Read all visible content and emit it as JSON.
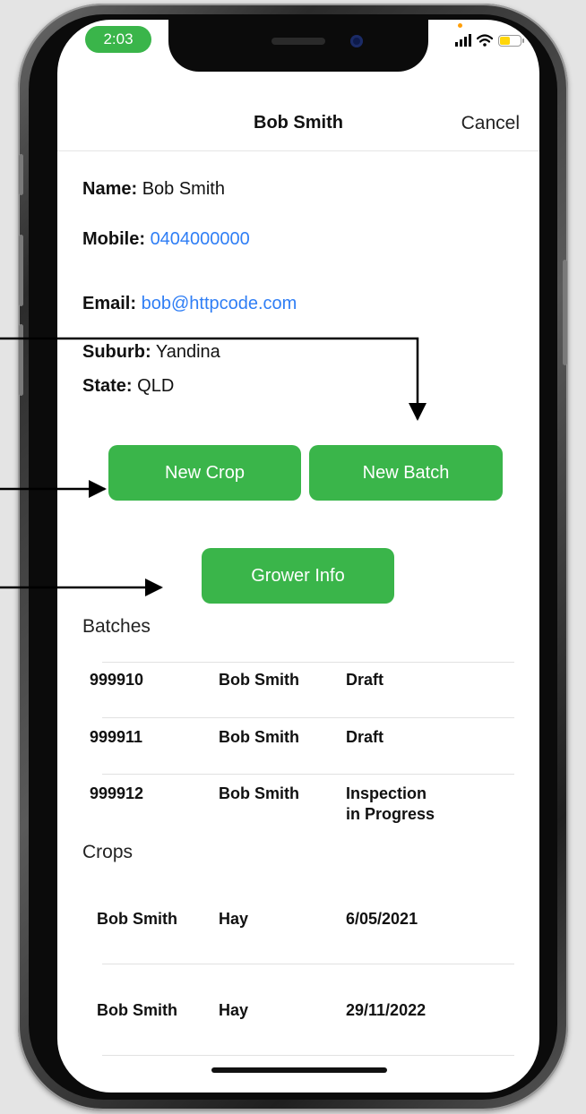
{
  "status_bar": {
    "time": "2:03"
  },
  "nav": {
    "title": "Bob Smith",
    "cancel_label": "Cancel"
  },
  "contact": {
    "name_label": "Name:",
    "name_value": "Bob Smith",
    "mobile_label": "Mobile:",
    "mobile_value": "0404000000",
    "email_label": "Email:",
    "email_value": "bob@httpcode.com",
    "suburb_label": "Suburb:",
    "suburb_value": "Yandina",
    "state_label": "State:",
    "state_value": "QLD"
  },
  "buttons": {
    "new_crop": "New Crop",
    "new_batch": "New Batch",
    "grower_info": "Grower Info"
  },
  "batches": {
    "title": "Batches",
    "rows": [
      {
        "id": "999910",
        "name": "Bob Smith",
        "status": "Draft"
      },
      {
        "id": "999911",
        "name": "Bob Smith",
        "status": "Draft"
      },
      {
        "id": "999912",
        "name": "Bob Smith",
        "status_line1": "Inspection",
        "status_line2": "in Progress"
      }
    ]
  },
  "crops": {
    "title": "Crops",
    "rows": [
      {
        "name": "Bob Smith",
        "crop": "Hay",
        "date": "6/05/2021"
      },
      {
        "name": "Bob Smith",
        "crop": "Hay",
        "date": "29/11/2022"
      }
    ]
  },
  "colors": {
    "accent_green": "#3ab54a",
    "link_blue": "#2f7ef5"
  }
}
